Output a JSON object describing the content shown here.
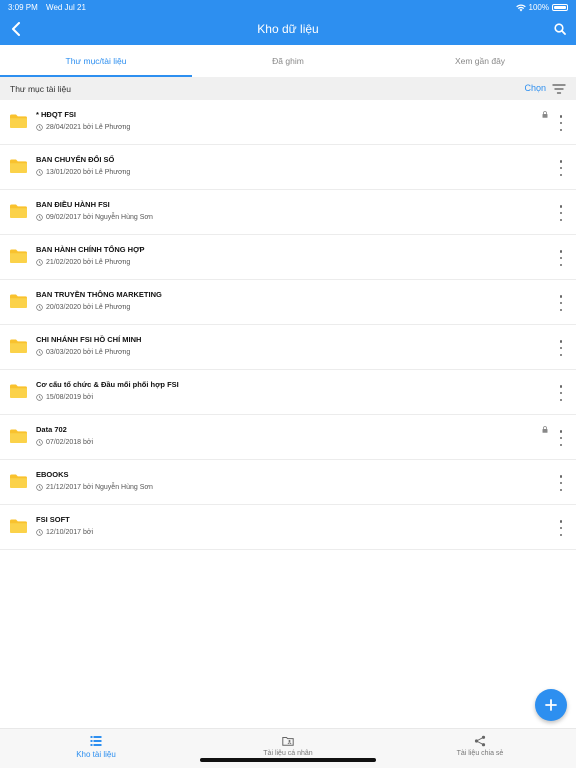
{
  "status_bar": {
    "time": "3:09 PM",
    "date": "Wed Jul 21",
    "battery": "100%"
  },
  "header": {
    "title": "Kho dữ liệu"
  },
  "tabs": [
    {
      "label": "Thư mục/tài liệu",
      "active": true
    },
    {
      "label": "Đã ghim",
      "active": false
    },
    {
      "label": "Xem gần đây",
      "active": false
    }
  ],
  "section": {
    "title": "Thư mục tài liệu",
    "choose_label": "Chọn"
  },
  "folders": [
    {
      "name": "* HĐQT FSI",
      "meta": "28/04/2021 bởi Lê Phương",
      "locked": true
    },
    {
      "name": "BAN CHUYỂN ĐỔI SỐ",
      "meta": "13/01/2020 bởi Lê Phương",
      "locked": false
    },
    {
      "name": "BAN ĐIỀU HÀNH FSI",
      "meta": "09/02/2017 bởi Nguyễn Hùng Sơn",
      "locked": false
    },
    {
      "name": "BAN HÀNH CHÍNH TỔNG HỢP",
      "meta": "21/02/2020 bởi Lê Phương",
      "locked": false
    },
    {
      "name": "BAN TRUYỀN THÔNG MARKETING",
      "meta": "20/03/2020 bởi Lê Phương",
      "locked": false
    },
    {
      "name": "CHI NHÁNH FSI HỒ CHÍ MINH",
      "meta": "03/03/2020 bởi Lê Phương",
      "locked": false
    },
    {
      "name": "Cơ cấu tổ chức & Đầu mối phối hợp FSI",
      "meta": "15/08/2019 bởi",
      "locked": false
    },
    {
      "name": "Data 702",
      "meta": "07/02/2018 bởi",
      "locked": true
    },
    {
      "name": "EBOOKS",
      "meta": "21/12/2017 bởi Nguyễn Hùng Sơn",
      "locked": false
    },
    {
      "name": "FSI SOFT",
      "meta": "12/10/2017 bởi",
      "locked": false
    }
  ],
  "bottom_nav": [
    {
      "label": "Kho tài liệu",
      "active": true,
      "icon": "list-icon"
    },
    {
      "label": "Tài liệu cá nhân",
      "active": false,
      "icon": "personal-folder-icon"
    },
    {
      "label": "Tài liệu chia sẻ",
      "active": false,
      "icon": "share-icon"
    }
  ],
  "colors": {
    "primary": "#2d8ff0",
    "folder": "#f9c22e",
    "section_bg": "#f0f0f0"
  }
}
